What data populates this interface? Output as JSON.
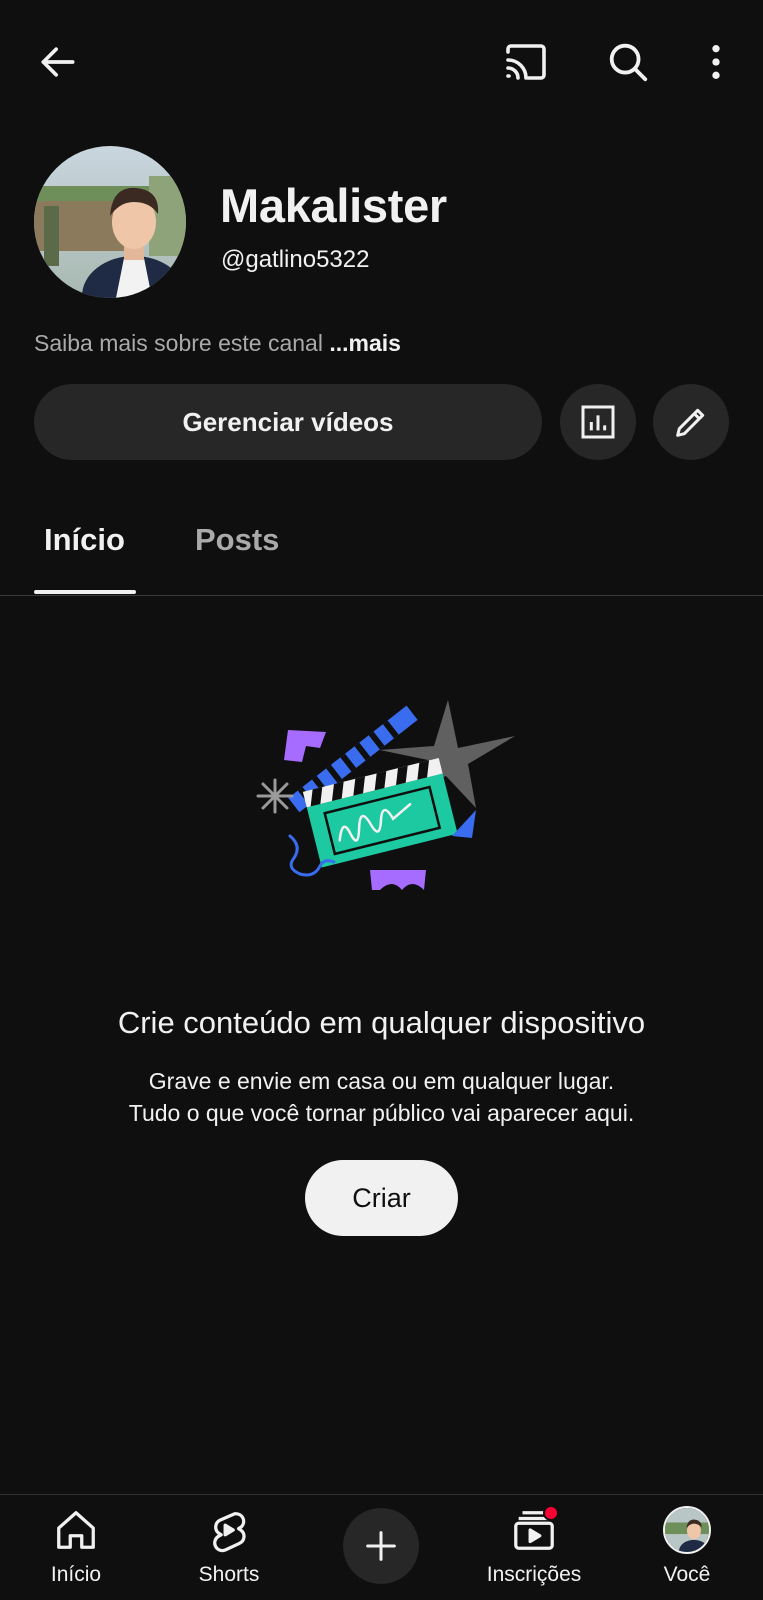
{
  "top_bar": {
    "back_icon": "arrow-left-icon",
    "cast_icon": "cast-icon",
    "search_icon": "search-icon",
    "menu_icon": "more-vertical-icon"
  },
  "channel": {
    "name": "Makalister",
    "handle": "@gatlino5322",
    "about_text": "Saiba mais sobre este canal",
    "about_more": "...mais"
  },
  "actions": {
    "manage_videos": "Gerenciar vídeos",
    "analytics_icon": "bar-chart-icon",
    "edit_icon": "pencil-icon"
  },
  "tabs": [
    {
      "label": "Início",
      "active": true
    },
    {
      "label": "Posts",
      "active": false
    }
  ],
  "empty_state": {
    "title": "Crie conteúdo em qualquer dispositivo",
    "line1": "Grave e envie em casa ou em qualquer lugar.",
    "line2": "Tudo o que você tornar público vai aparecer aqui.",
    "create_button": "Criar"
  },
  "bottom_nav": [
    {
      "label": "Início",
      "icon": "home-icon"
    },
    {
      "label": "Shorts",
      "icon": "shorts-icon"
    },
    {
      "label": "",
      "icon": "plus-icon"
    },
    {
      "label": "Inscrições",
      "icon": "subscriptions-icon",
      "notification": true
    },
    {
      "label": "Você",
      "icon": "avatar"
    }
  ],
  "colors": {
    "background": "#0f0f0f",
    "surface": "#272727",
    "text": "#f1f1f1",
    "muted": "#aaaaaa",
    "notification": "#ff0033",
    "accent_teal": "#1dc9a0",
    "accent_purple": "#a66cff",
    "accent_blue": "#3a6cf0"
  }
}
